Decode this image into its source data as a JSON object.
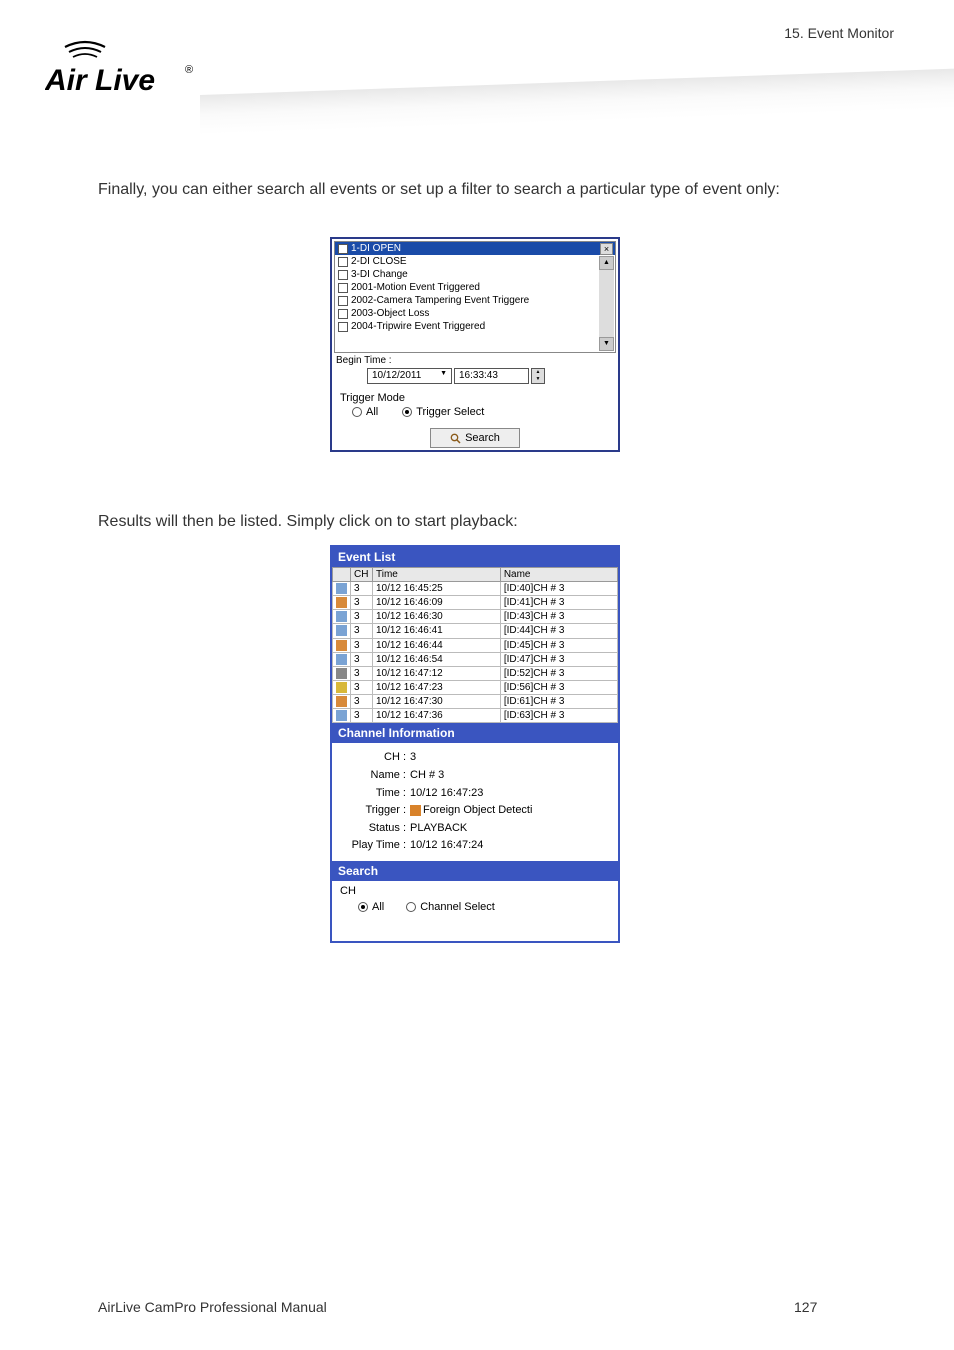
{
  "header": {
    "chapter": "15. Event Monitor"
  },
  "logo": {
    "name": "Air Live",
    "reg": "®"
  },
  "para1": "Finally, you can either search all events or set up a filter to search a particular type of event only:",
  "img1": {
    "items": [
      {
        "label": "1-DI OPEN",
        "selected": true
      },
      {
        "label": "2-DI CLOSE",
        "selected": false
      },
      {
        "label": "3-DI Change",
        "selected": false
      },
      {
        "label": "2001-Motion Event Triggered",
        "selected": false
      },
      {
        "label": "2002-Camera Tampering Event Triggere",
        "selected": false
      },
      {
        "label": "2003-Object Loss",
        "selected": false
      },
      {
        "label": "2004-Tripwire Event Triggered",
        "selected": false
      }
    ],
    "begin": "Begin Time :",
    "date": "10/12/2011",
    "time": "16:33:43",
    "trigger_label": "Trigger Mode",
    "radio_all": "All",
    "radio_sel": "Trigger Select",
    "search_btn": "Search"
  },
  "para2": "Results will then be listed. Simply click on to start playback:",
  "img2": {
    "title": "Event List",
    "cols": {
      "icon": "",
      "ch": "CH",
      "time": "Time",
      "name": "Name"
    },
    "rows": [
      {
        "ico": "#7aa3d4",
        "ch": "3",
        "time": "10/12 16:45:25",
        "name": "[ID:40]CH # 3"
      },
      {
        "ico": "#d88a3a",
        "ch": "3",
        "time": "10/12 16:46:09",
        "name": "[ID:41]CH # 3"
      },
      {
        "ico": "#7aa3d4",
        "ch": "3",
        "time": "10/12 16:46:30",
        "name": "[ID:43]CH # 3"
      },
      {
        "ico": "#7aa3d4",
        "ch": "3",
        "time": "10/12 16:46:41",
        "name": "[ID:44]CH # 3"
      },
      {
        "ico": "#d88a3a",
        "ch": "3",
        "time": "10/12 16:46:44",
        "name": "[ID:45]CH # 3"
      },
      {
        "ico": "#7aa3d4",
        "ch": "3",
        "time": "10/12 16:46:54",
        "name": "[ID:47]CH # 3"
      },
      {
        "ico": "#888888",
        "ch": "3",
        "time": "10/12 16:47:12",
        "name": "[ID:52]CH # 3"
      },
      {
        "ico": "#d8b83a",
        "ch": "3",
        "time": "10/12 16:47:23",
        "name": "[ID:56]CH # 3"
      },
      {
        "ico": "#d88a3a",
        "ch": "3",
        "time": "10/12 16:47:30",
        "name": "[ID:61]CH # 3"
      },
      {
        "ico": "#7aa3d4",
        "ch": "3",
        "time": "10/12 16:47:36",
        "name": "[ID:63]CH # 3"
      }
    ],
    "chinfo_title": "Channel Information",
    "info": {
      "ch_lbl": "CH :",
      "ch_val": "3",
      "name_lbl": "Name :",
      "name_val": "CH # 3",
      "time_lbl": "Time :",
      "time_val": "10/12 16:47:23",
      "trigger_lbl": "Trigger :",
      "trigger_val": "Foreign Object Detecti",
      "status_lbl": "Status :",
      "status_val": "PLAYBACK",
      "play_lbl": "Play Time :",
      "play_val": "10/12 16:47:24"
    },
    "search_title": "Search",
    "ch_label": "CH",
    "radio_all": "All",
    "radio_chsel": "Channel Select"
  },
  "footer": {
    "left": "AirLive CamPro Professional Manual",
    "page": "127"
  }
}
